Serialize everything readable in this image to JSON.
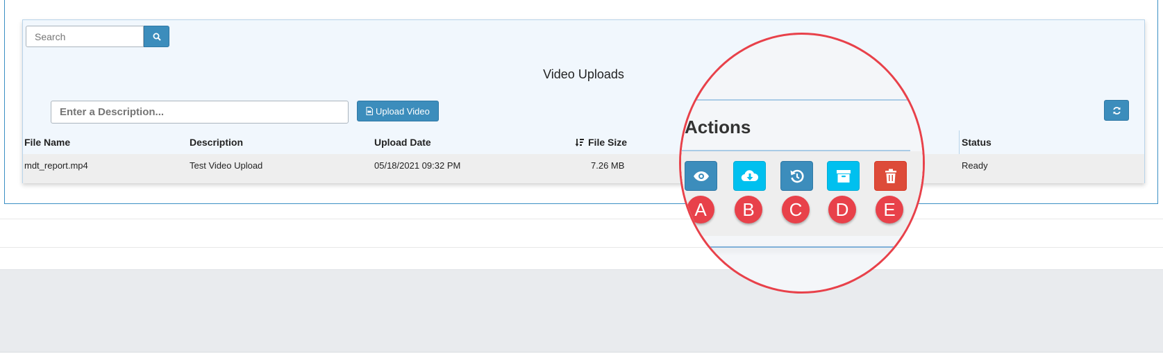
{
  "search": {
    "placeholder": "Search"
  },
  "panel": {
    "title": "Video Uploads"
  },
  "upload": {
    "description_placeholder": "Enter a Description...",
    "button_label": "Upload Video"
  },
  "table": {
    "columns": [
      "File Name",
      "Description",
      "Upload Date",
      "File Size",
      "Status"
    ],
    "sorted_column": "File Size",
    "rows": [
      {
        "file_name": "mdt_report.mp4",
        "description": "Test Video Upload",
        "upload_date": "05/18/2021 09:32 PM",
        "file_size": "7.26 MB",
        "status": "Ready"
      }
    ]
  },
  "callout": {
    "title": "Actions",
    "buttons": [
      {
        "letter": "A",
        "icon": "eye-icon",
        "color": "#3c8dbc"
      },
      {
        "letter": "B",
        "icon": "cloud-download-icon",
        "color": "#00c0ef"
      },
      {
        "letter": "C",
        "icon": "history-icon",
        "color": "#3c8dbc"
      },
      {
        "letter": "D",
        "icon": "archive-icon",
        "color": "#00c0ef"
      },
      {
        "letter": "E",
        "icon": "trash-icon",
        "color": "#dd4b39"
      }
    ],
    "ring_color": "#e8414a"
  },
  "colors": {
    "primary": "#3c8dbc",
    "info": "#00c0ef",
    "danger": "#dd4b39",
    "panel_bg": "#f1f7fd"
  }
}
